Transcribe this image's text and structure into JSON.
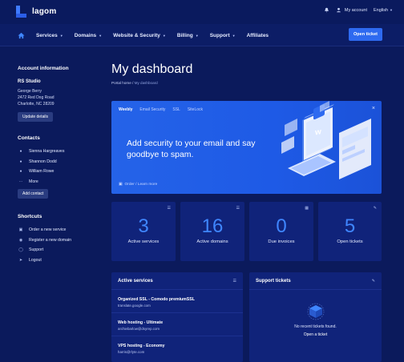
{
  "brand": {
    "name": "lagom"
  },
  "topbar": {
    "my_account": "My account",
    "language": "English"
  },
  "nav": {
    "items": [
      {
        "label": "Services"
      },
      {
        "label": "Domains"
      },
      {
        "label": "Website & Security"
      },
      {
        "label": "Billing"
      },
      {
        "label": "Support"
      },
      {
        "label": "Affiliates"
      }
    ],
    "open_ticket": "Open ticket"
  },
  "sidebar": {
    "account_heading": "Account information",
    "company": "RS Studio",
    "address": [
      "George Berry",
      "2472 Red Dog Road",
      "Charlotte, NC 28209"
    ],
    "update_btn": "Update details",
    "contacts_heading": "Contacts",
    "contacts": [
      {
        "label": "Sienna Hargreaves"
      },
      {
        "label": "Shannon Dodd"
      },
      {
        "label": "William Rowe"
      },
      {
        "label": "More"
      }
    ],
    "add_contact": "Add contact",
    "shortcuts_heading": "Shortcuts",
    "shortcuts": [
      {
        "label": "Order a new service"
      },
      {
        "label": "Register a new domain"
      },
      {
        "label": "Support"
      },
      {
        "label": "Logout"
      }
    ]
  },
  "page": {
    "title": "My dashboard",
    "breadcrumb_home": "Portal home",
    "breadcrumb_sep": "/",
    "breadcrumb_current": "My dashboard"
  },
  "banner": {
    "tabs": [
      "Weebly",
      "Email Security",
      "SSL",
      "SiteLock"
    ],
    "headline": "Add security to your email and say goodbye to spam.",
    "link": "Order / Learn more",
    "close": "×"
  },
  "stats": [
    {
      "value": "3",
      "label": "Active services"
    },
    {
      "value": "16",
      "label": "Active domains"
    },
    {
      "value": "0",
      "label": "Due invoices"
    },
    {
      "value": "5",
      "label": "Open tickets"
    }
  ],
  "services_panel": {
    "title": "Active services",
    "rows": [
      {
        "name": "Organized SSL - Comodo premiumSSL",
        "domain": "translate.google.com"
      },
      {
        "name": "Web hosting - Ultimate",
        "domain": "archiebarlow@dsyrep.com"
      },
      {
        "name": "VPS hosting - Economy",
        "domain": "harris@rlyte.com"
      }
    ]
  },
  "tickets_panel": {
    "title": "Support tickets",
    "empty": "No recent tickets found.",
    "link": "Open a ticket"
  },
  "colors": {
    "background": "#0b1a5c",
    "card": "#10237a",
    "accent": "#2e6af0",
    "stat_number": "#3f86ff"
  }
}
